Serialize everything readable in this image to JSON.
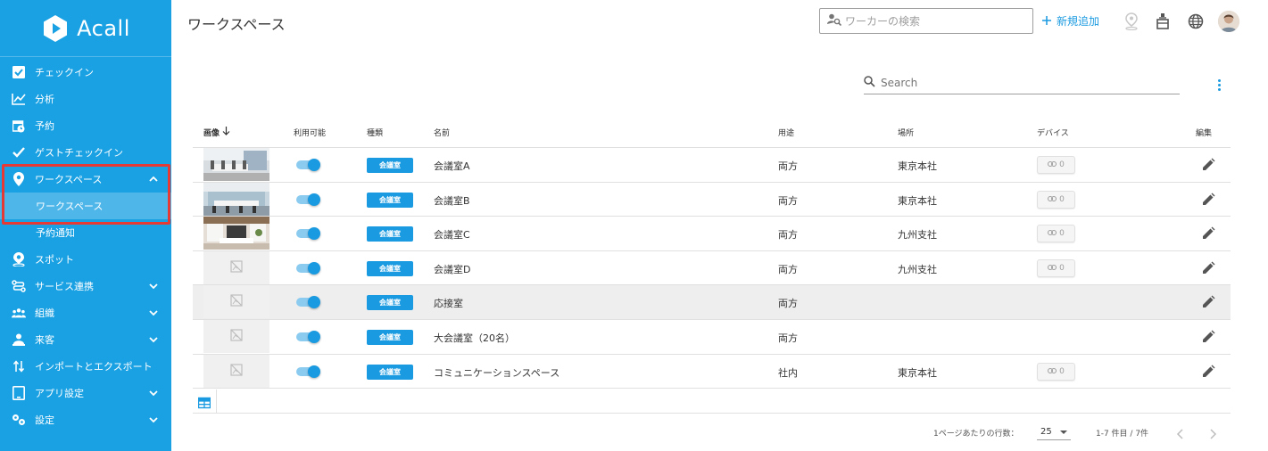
{
  "app": {
    "logo_text": "Acall"
  },
  "sidebar": {
    "items": [
      {
        "label": "チェックイン",
        "icon": "checkbox-icon"
      },
      {
        "label": "分析",
        "icon": "chart-line-icon"
      },
      {
        "label": "予約",
        "icon": "calendar-clock-icon"
      },
      {
        "label": "ゲストチェックイン",
        "icon": "check-icon"
      },
      {
        "label": "ワークスペース",
        "icon": "map-pin-icon",
        "expanded": true
      },
      {
        "label": "ワークスペース",
        "sub": true,
        "active": true
      },
      {
        "label": "予約通知",
        "sub": true
      },
      {
        "label": "スポット",
        "icon": "person-pin-icon"
      },
      {
        "label": "サービス連携",
        "icon": "integration-icon"
      },
      {
        "label": "組織",
        "icon": "people-icon"
      },
      {
        "label": "来客",
        "icon": "visitor-icon"
      },
      {
        "label": "インポートとエクスポート",
        "icon": "import-export-icon"
      },
      {
        "label": "アプリ設定",
        "icon": "tablet-icon"
      },
      {
        "label": "設定",
        "icon": "settings-icon"
      }
    ]
  },
  "header": {
    "title": "ワークスペース",
    "worker_search_placeholder": "ワーカーの検索",
    "add_new_label": "新規追加"
  },
  "table": {
    "search_placeholder": "Search",
    "columns": {
      "image": "画像",
      "available": "利用可能",
      "type": "種類",
      "name": "名前",
      "use": "用途",
      "place": "場所",
      "device": "デバイス",
      "edit": "編集"
    },
    "rows": [
      {
        "image": "photo",
        "type": "会議室",
        "name": "会議室A",
        "use": "両方",
        "place": "東京本社",
        "devices": "0"
      },
      {
        "image": "photo",
        "type": "会議室",
        "name": "会議室B",
        "use": "両方",
        "place": "東京本社",
        "devices": "0"
      },
      {
        "image": "photo",
        "type": "会議室",
        "name": "会議室C",
        "use": "両方",
        "place": "九州支社",
        "devices": "0"
      },
      {
        "image": "none",
        "type": "会議室",
        "name": "会議室D",
        "use": "両方",
        "place": "九州支社",
        "devices": "0"
      },
      {
        "image": "none",
        "type": "会議室",
        "name": "応接室",
        "use": "両方",
        "place": "",
        "devices": ""
      },
      {
        "image": "none",
        "type": "会議室",
        "name": "大会議室（20名）",
        "use": "両方",
        "place": "",
        "devices": ""
      },
      {
        "image": "none",
        "type": "会議室",
        "name": "コミュニケーションスペース",
        "use": "社内",
        "place": "東京本社",
        "devices": "0"
      }
    ]
  },
  "pagination": {
    "rows_per_page_label": "1ページあたりの行数：",
    "rows_per_page": "25",
    "range": "1-7 件目 / 7件"
  }
}
